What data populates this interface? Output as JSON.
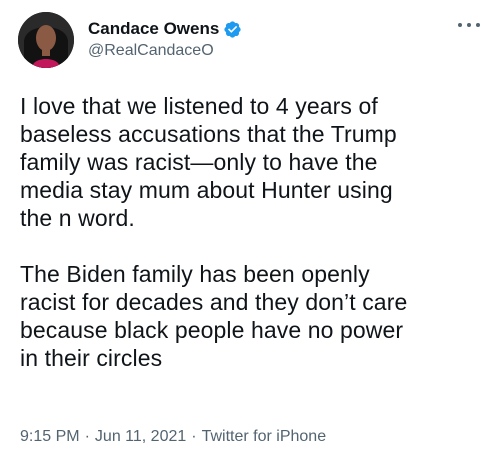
{
  "tweet": {
    "author": {
      "display_name": "Candace Owens",
      "handle": "@RealCandaceO",
      "verified": true,
      "avatar_icon": "profile-photo"
    },
    "more_icon": "ellipsis-icon",
    "paragraph1": "I love that we listened to 4 years of\nbaseless accusations that the Trump\nfamily was racist—only to have the\nmedia stay mum about Hunter using\nthe n word.",
    "paragraph2": "The Biden family has been openly\nracist for decades and they don’t care\nbecause black people have no power\nin their circles",
    "time": "9:15 PM",
    "date": "Jun 11, 2021",
    "source": "Twitter for iPhone",
    "separator": "·"
  },
  "colors": {
    "text": "#0f1419",
    "secondary": "#536471",
    "verified": "#1d9bf0"
  }
}
